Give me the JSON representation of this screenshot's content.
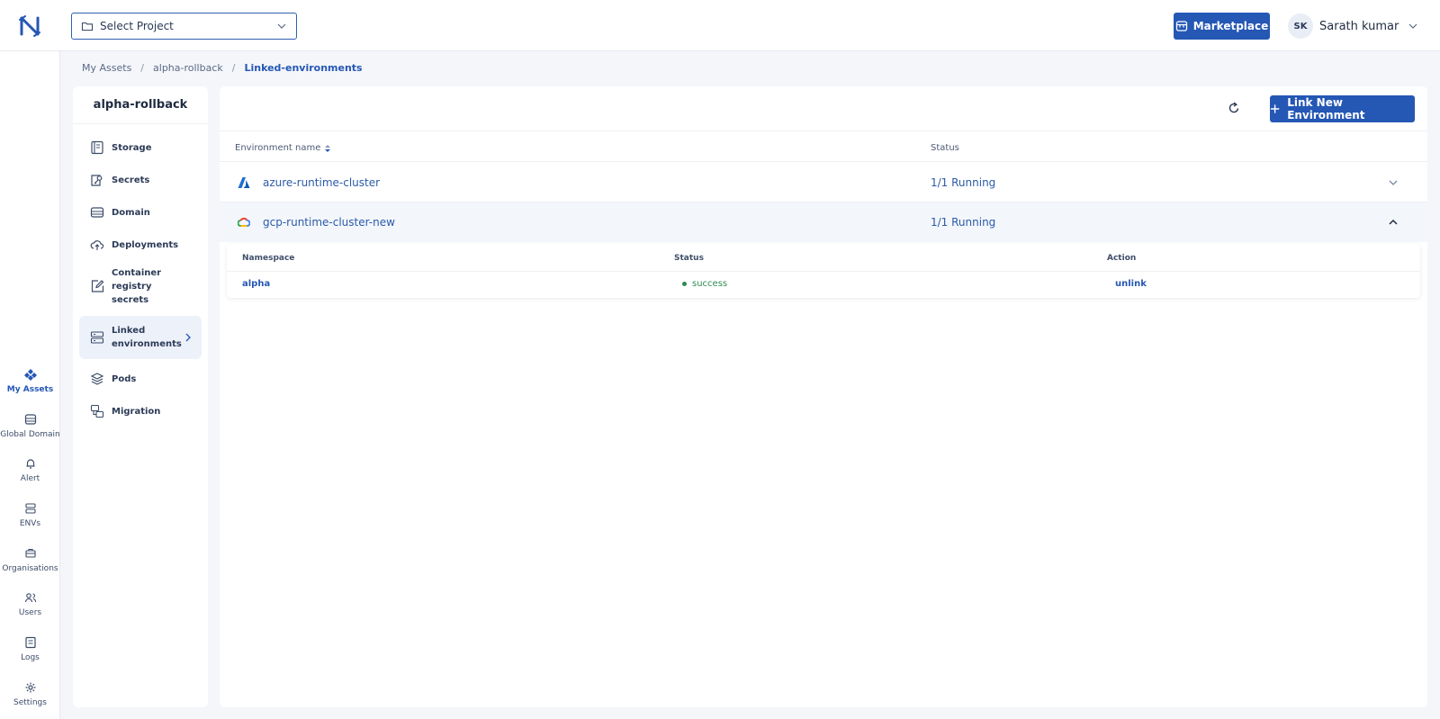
{
  "header": {
    "project_select_label": "Select Project",
    "marketplace_label": "Marketplace",
    "user": {
      "initials": "SK",
      "name": "Sarath kumar"
    },
    "accent": "#2557b5"
  },
  "rail": {
    "items": [
      {
        "label": "My Assets",
        "icon": "diamond-grid-icon",
        "active": true
      },
      {
        "label": "Global Domain",
        "icon": "globe-server-icon"
      },
      {
        "label": "Alert",
        "icon": "bell-icon"
      },
      {
        "label": "ENVs",
        "icon": "server-stack-icon"
      },
      {
        "label": "Organisations",
        "icon": "briefcase-icon"
      },
      {
        "label": "Users",
        "icon": "users-icon"
      },
      {
        "label": "Logs",
        "icon": "log-book-icon"
      },
      {
        "label": "Settings",
        "icon": "gear-icon"
      }
    ]
  },
  "breadcrumb": {
    "root": "My Assets",
    "asset": "alpha-rollback",
    "current": "Linked-environments"
  },
  "subnav": {
    "title": "alpha-rollback",
    "items": [
      {
        "label": "Storage",
        "icon": "storage-icon"
      },
      {
        "label": "Secrets",
        "icon": "secrets-icon"
      },
      {
        "label": "Domain",
        "icon": "domain-icon"
      },
      {
        "label": "Deployments",
        "icon": "cloud-upload-icon"
      },
      {
        "label": "Container registry secrets",
        "icon": "edit-box-icon"
      },
      {
        "label": "Linked environments",
        "icon": "linked-env-icon",
        "active": true
      },
      {
        "label": "Pods",
        "icon": "layers-icon"
      },
      {
        "label": "Migration",
        "icon": "migration-icon"
      }
    ]
  },
  "main": {
    "link_button_label": "Link New Environment",
    "columns": {
      "env_name": "Environment name",
      "status": "Status"
    },
    "environments": [
      {
        "name": "azure-runtime-cluster",
        "status": "1/1 Running",
        "provider_icon": "azure-icon",
        "expanded": false
      },
      {
        "name": "gcp-runtime-cluster-new",
        "status": "1/1 Running",
        "provider_icon": "gcp-icon",
        "expanded": true
      }
    ],
    "namespace_table": {
      "columns": {
        "namespace": "Namespace",
        "status": "Status",
        "action": "Action"
      },
      "rows": [
        {
          "namespace": "alpha",
          "status": "success",
          "action": "unlink"
        }
      ]
    }
  }
}
